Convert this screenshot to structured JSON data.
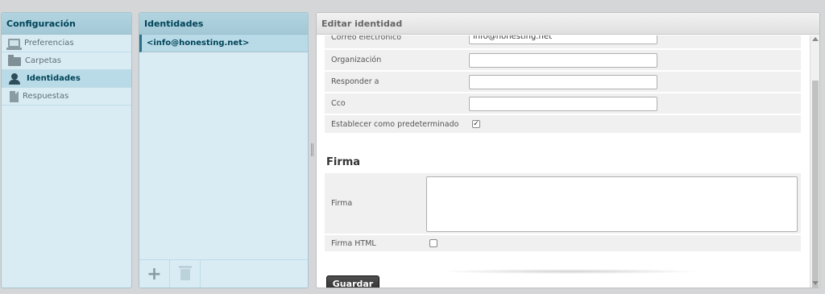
{
  "config_panel": {
    "title": "Configuración",
    "items": [
      {
        "label": "Preferencias",
        "icon": "monitor-icon"
      },
      {
        "label": "Carpetas",
        "icon": "folder-icon"
      },
      {
        "label": "Identidades",
        "icon": "person-icon",
        "active": true
      },
      {
        "label": "Respuestas",
        "icon": "document-icon"
      }
    ]
  },
  "identities_panel": {
    "title": "Identidades",
    "selected_identity": "<info@honesting.net>",
    "add_label": "+"
  },
  "edit_panel": {
    "title": "Editar identidad",
    "fields": {
      "email": {
        "label": "Correo electrónico",
        "value": "info@honesting.net"
      },
      "organization": {
        "label": "Organización",
        "value": ""
      },
      "reply_to": {
        "label": "Responder a",
        "value": ""
      },
      "bcc": {
        "label": "Cco",
        "value": ""
      },
      "default": {
        "label": "Establecer como predeterminado",
        "checked": true
      }
    },
    "signature_section": {
      "title": "Firma",
      "signature_label": "Firma",
      "signature_value": "",
      "html_label": "Firma HTML",
      "html_checked": false
    },
    "save_label": "Guardar"
  },
  "colors": {
    "panel_bg": "#d9ecf4",
    "header_text": "#004458",
    "active_item": "#b9dae7",
    "save_button": "#2a2a2a"
  }
}
